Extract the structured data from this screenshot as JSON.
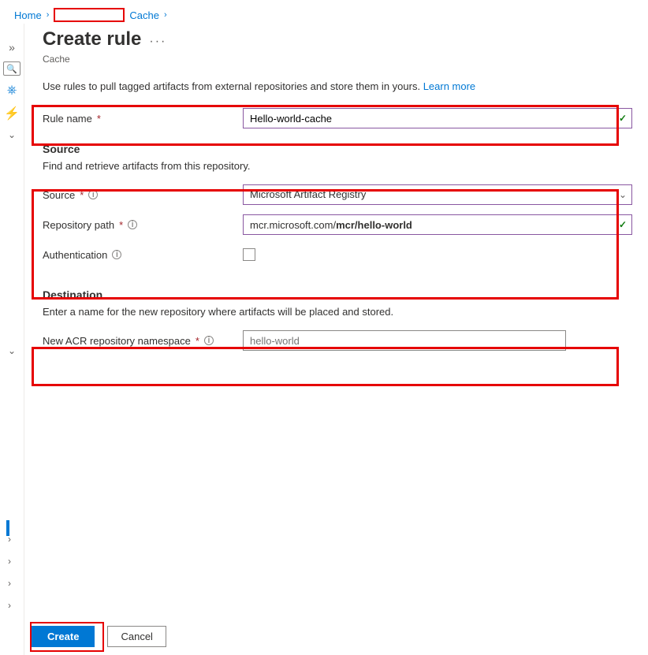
{
  "breadcrumb": {
    "home": "Home",
    "cache": "Cache"
  },
  "page": {
    "title": "Create rule",
    "subtitle": "Cache",
    "description": "Use rules to pull tagged artifacts from external repositories and store them in yours.",
    "learn_more": "Learn more"
  },
  "form": {
    "rule_name_label": "Rule name",
    "rule_name_value": "Hello-world-cache",
    "source_section": "Source",
    "source_section_sub": "Find and retrieve artifacts from this repository.",
    "source_label": "Source",
    "source_value": "Microsoft Artifact Registry",
    "repo_path_label": "Repository path",
    "repo_path_prefix": "mcr.microsoft.com/",
    "repo_path_value": "mcr/hello-world",
    "auth_label": "Authentication",
    "dest_section": "Destination",
    "dest_section_sub": "Enter a name for the new repository where artifacts will be placed and stored.",
    "namespace_label": "New ACR repository namespace",
    "namespace_value": "hello-world"
  },
  "footer": {
    "create": "Create",
    "cancel": "Cancel"
  }
}
